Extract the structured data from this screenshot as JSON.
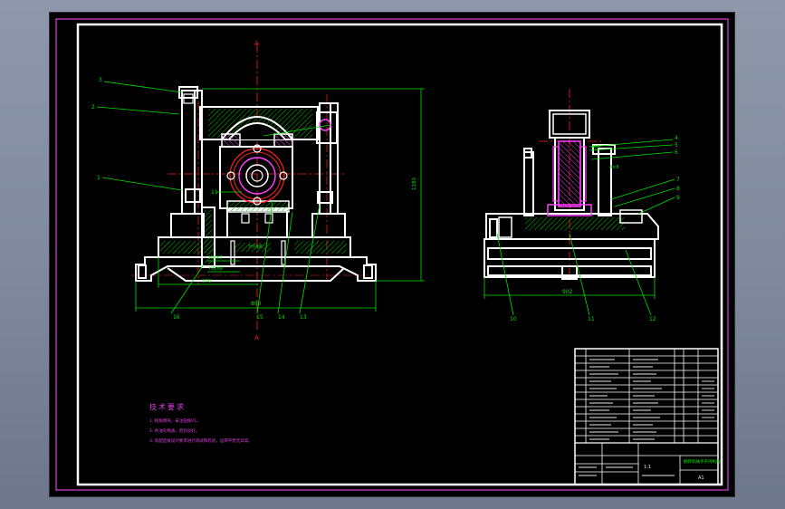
{
  "labels": {
    "section_mark_top": "A",
    "section_mark_bottom": "A",
    "overall_width_front": "890",
    "base_width_front": "570",
    "overall_height": "1180",
    "fit_1": "H8/h7",
    "fit_2": "H8/h8",
    "fit_3": "H7/p6",
    "overall_width_side": "902",
    "side_dim_1": "405",
    "side_dim_2": "4×8"
  },
  "balloons": {
    "front": [
      "3",
      "2",
      "1",
      "16",
      "15",
      "14",
      "13",
      "11"
    ],
    "side": [
      "4",
      "5",
      "6",
      "7",
      "8",
      "9",
      "10",
      "11",
      "12"
    ]
  },
  "technical_requirements": {
    "title": "技术要求",
    "notes": [
      "1. 锐角倒钝，未注圆角R1。",
      "2. 各油孔畅通，密封良好。",
      "3. 装配后按设计要求进行调试和检验，运转平稳无异常。"
    ]
  },
  "title_block": {
    "drawing_name": "翻转机械手夹持机构",
    "scale": "1:1",
    "sheet": "A1"
  },
  "colors": {
    "background": "#000000",
    "outline": "#ffffff",
    "centerline": "#ff2020",
    "dimension": "#00e000",
    "hatch": "#00e000",
    "frame": "#e040e0",
    "notes": "#e040e0",
    "label_magenta": "#ff40ff"
  }
}
